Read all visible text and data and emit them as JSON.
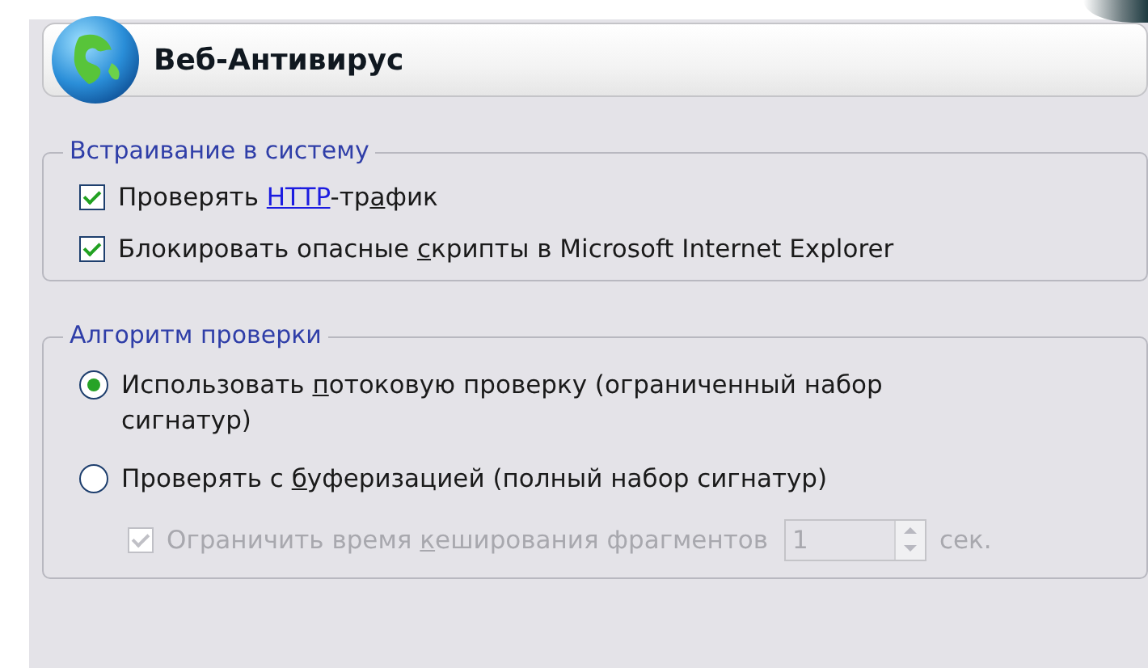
{
  "header": {
    "title": "Веб-Антивирус"
  },
  "groups": [
    {
      "title": "Встраивание в систему",
      "items": [
        {
          "kind": "checkbox",
          "checked": true,
          "disabled": false,
          "label": [
            {
              "kind": "text",
              "text": "Проверять "
            },
            {
              "kind": "link",
              "text": "HTTP"
            },
            {
              "kind": "text",
              "text": "-тр"
            },
            {
              "kind": "mnemonic",
              "text": "а"
            },
            {
              "kind": "text",
              "text": "фик"
            }
          ]
        },
        {
          "kind": "checkbox",
          "checked": true,
          "disabled": false,
          "label": [
            {
              "kind": "text",
              "text": "Блокировать опасные "
            },
            {
              "kind": "mnemonic",
              "text": "с"
            },
            {
              "kind": "text",
              "text": "крипты в Microsoft Internet Explorer"
            }
          ]
        }
      ]
    },
    {
      "title": "Алгоритм проверки",
      "items": [
        {
          "kind": "radio",
          "selected": true,
          "disabled": false,
          "label": [
            {
              "kind": "text",
              "text": "Использовать "
            },
            {
              "kind": "mnemonic",
              "text": "п"
            },
            {
              "kind": "text",
              "text": "отоковую проверку (ограниченный набор сигнатур)"
            }
          ]
        },
        {
          "kind": "radio",
          "selected": false,
          "disabled": false,
          "label": [
            {
              "kind": "text",
              "text": "Проверять с "
            },
            {
              "kind": "mnemonic",
              "text": "б"
            },
            {
              "kind": "text",
              "text": "уферизацией (полный набор сигнатур)"
            }
          ]
        },
        {
          "kind": "sub-checkbox",
          "checked": true,
          "disabled": true,
          "label": [
            {
              "kind": "text",
              "text": "Ограничить время "
            },
            {
              "kind": "mnemonic",
              "text": "к"
            },
            {
              "kind": "text",
              "text": "еширования фрагментов"
            }
          ],
          "spin_value": "1",
          "unit": "сек."
        }
      ]
    }
  ]
}
